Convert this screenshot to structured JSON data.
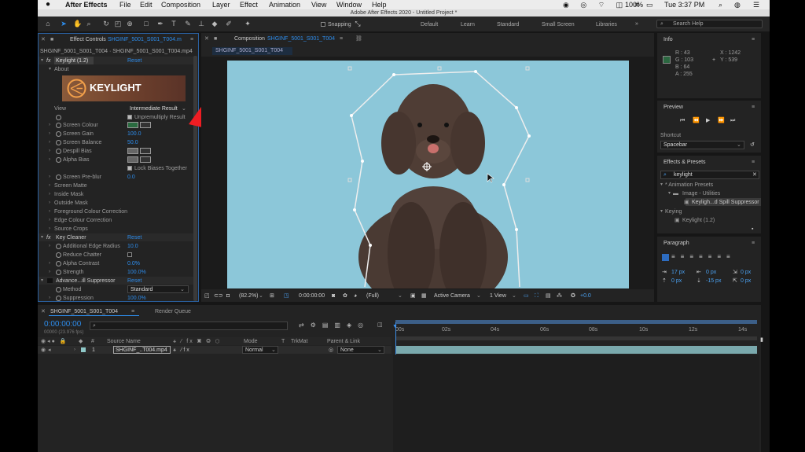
{
  "menubar": {
    "app": "After Effects",
    "items": [
      "File",
      "Edit",
      "Composition",
      "Layer",
      "Effect",
      "Animation",
      "View",
      "Window",
      "Help"
    ],
    "battery": "100%",
    "clock": "Tue 3:37 PM"
  },
  "titlebar": {
    "title": "Adobe After Effects 2020 - Untitled Project *"
  },
  "toolbar": {
    "snapping": "Snapping",
    "workspaces": [
      "Default",
      "Learn",
      "Standard",
      "Small Screen",
      "Libraries"
    ],
    "search": "Search Help"
  },
  "effect_controls": {
    "tab": "Effect Controls",
    "tab_file": "SHGINF_5001_S001_T004.m",
    "breadcrumb": "SHGINF_5001_S001_T004 · SHGINF_5001_S001_T004.mp4",
    "keylight": {
      "name": "Keylight (1.2)",
      "reset": "Reset",
      "about": "About",
      "banner": "KEYLIGHT",
      "view_label": "View",
      "view_value": "Intermediate Result",
      "unpremultiply": "Unpremultiply Result",
      "screen_colour": "Screen Colour",
      "screen_gain": "Screen Gain",
      "screen_gain_val": "100.0",
      "screen_balance": "Screen Balance",
      "screen_balance_val": "50.0",
      "despill": "Despill Bias",
      "alpha_bias": "Alpha Bias",
      "lock_biases": "Lock Biases Together",
      "preblur": "Screen Pre-blur",
      "preblur_val": "0.0",
      "groups": [
        "Screen Matte",
        "Inside Mask",
        "Outside Mask",
        "Foreground Colour Correction",
        "Edge Colour Correction",
        "Source Crops"
      ]
    },
    "key_cleaner": {
      "name": "Key Cleaner",
      "reset": "Reset",
      "edge_radius": "Additional Edge Radius",
      "edge_radius_val": "10.0",
      "reduce_chatter": "Reduce Chatter",
      "alpha_contrast": "Alpha Contrast",
      "alpha_contrast_val": "0.0%",
      "strength": "Strength",
      "strength_val": "100.0%"
    },
    "advanced": {
      "name": "Advance...ill Suppressor",
      "reset": "Reset",
      "method": "Method",
      "method_val": "Standard",
      "suppression": "Suppression",
      "suppression_val": "100.0%"
    }
  },
  "composition": {
    "tab": "Composition",
    "tab_name": "SHGINF_5001_S001_T004",
    "sub_tab": "SHGINF_5001_S001_T004",
    "footer": {
      "zoom": "(82.2%)",
      "timecode": "0:00:00:00",
      "resolution": "(Full)",
      "camera": "Active Camera",
      "views": "1 View",
      "exposure": "+0.0"
    }
  },
  "info": {
    "title": "Info",
    "r": "R : 43",
    "g": "G : 103",
    "b": "B : 64",
    "a": "A : 255",
    "x": "X : 1242",
    "y": "Y : 539",
    "swatch": "#2b6740"
  },
  "preview": {
    "title": "Preview",
    "shortcut_label": "Shortcut",
    "shortcut": "Spacebar"
  },
  "effects_presets": {
    "title": "Effects & Presets",
    "search": "keylight",
    "tree": [
      "* Animation Presets",
      "Image - Utilities",
      "Keyligh...d Spill Suppressor",
      "Keying",
      "Keylight (1.2)"
    ]
  },
  "paragraph": {
    "title": "Paragraph",
    "v1": "17 px",
    "v2": "0 px",
    "v3": "0 px",
    "v4": "0 px",
    "v5": "-15 px",
    "v6": "0 px"
  },
  "timeline": {
    "tab": "SHGINF_5001_S001_T004",
    "render_queue": "Render Queue",
    "timecode": "0:00:00:00",
    "fps": "00000 (23.976 fps)",
    "columns": {
      "source": "Source Name",
      "mode": "Mode",
      "t": "T",
      "trkmat": "TrkMat",
      "parent": "Parent & Link"
    },
    "layer": {
      "index": "1",
      "name": "SHGINF_..T004.mp4",
      "mode": "Normal",
      "parent": "None"
    },
    "ruler": [
      "00s",
      "02s",
      "04s",
      "06s",
      "08s",
      "10s",
      "12s",
      "14s"
    ]
  }
}
